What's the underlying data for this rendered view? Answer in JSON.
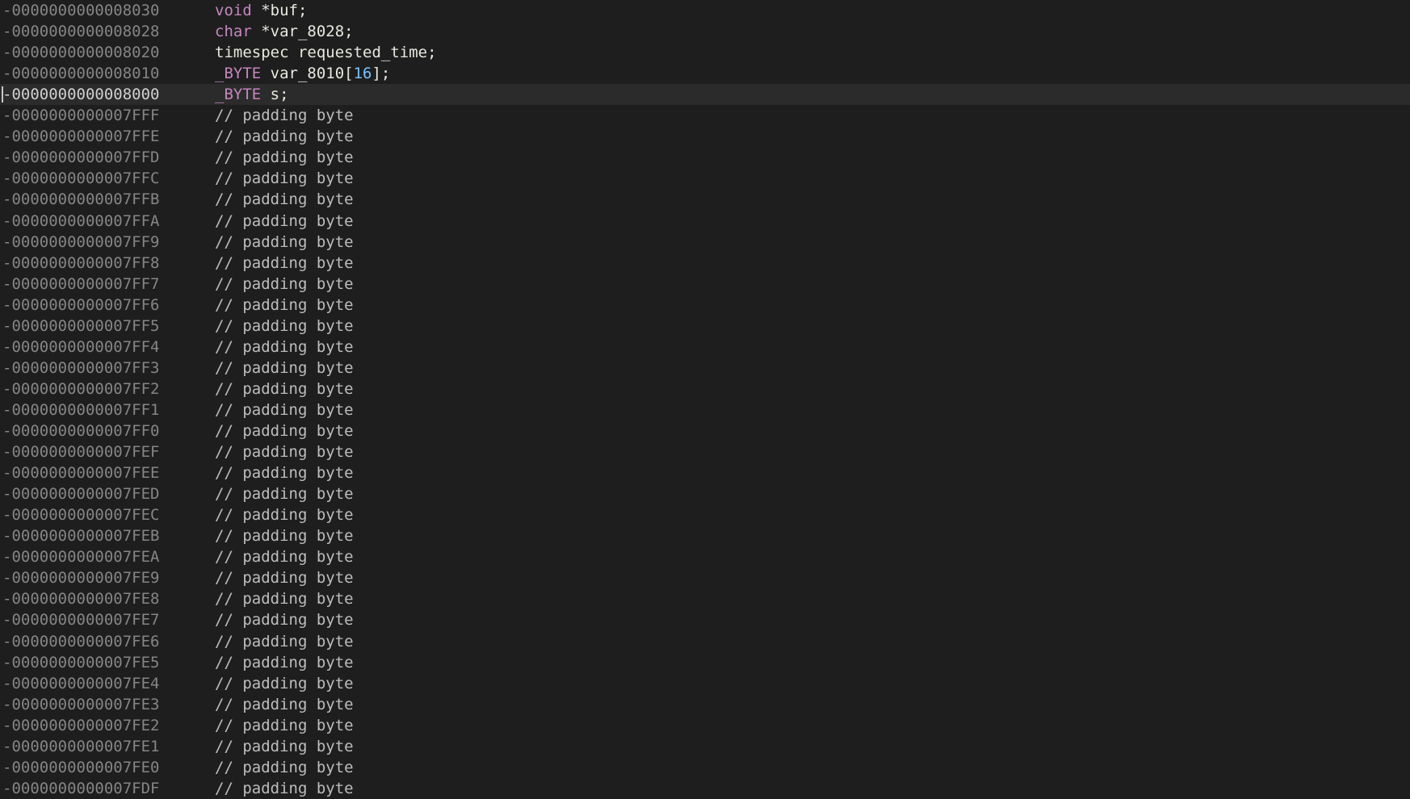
{
  "colors": {
    "background": "#1e1e1e",
    "current_line": "#2b2b2b",
    "offset": "#858585",
    "keyword": "#c586c0",
    "identifier": "#e8e8e0",
    "number": "#79c0ff",
    "comment": "#bdbdbd"
  },
  "rows": [
    {
      "offset": "-0000000000008030",
      "type": "void",
      "decl": " *buf;"
    },
    {
      "offset": "-0000000000008028",
      "type": "char",
      "decl": " *var_8028;"
    },
    {
      "offset": "-0000000000008020",
      "type": "timespec",
      "decl": " requested_time;"
    },
    {
      "offset": "-0000000000008010",
      "type": "_BYTE",
      "decl": " var_8010[",
      "num": "16",
      "tail": "];"
    },
    {
      "offset": "-0000000000008000",
      "type": "_BYTE",
      "decl": " s;",
      "current": true
    },
    {
      "offset": "-0000000000007FFF",
      "comment": "// padding byte"
    },
    {
      "offset": "-0000000000007FFE",
      "comment": "// padding byte"
    },
    {
      "offset": "-0000000000007FFD",
      "comment": "// padding byte"
    },
    {
      "offset": "-0000000000007FFC",
      "comment": "// padding byte"
    },
    {
      "offset": "-0000000000007FFB",
      "comment": "// padding byte"
    },
    {
      "offset": "-0000000000007FFA",
      "comment": "// padding byte"
    },
    {
      "offset": "-0000000000007FF9",
      "comment": "// padding byte"
    },
    {
      "offset": "-0000000000007FF8",
      "comment": "// padding byte"
    },
    {
      "offset": "-0000000000007FF7",
      "comment": "// padding byte"
    },
    {
      "offset": "-0000000000007FF6",
      "comment": "// padding byte"
    },
    {
      "offset": "-0000000000007FF5",
      "comment": "// padding byte"
    },
    {
      "offset": "-0000000000007FF4",
      "comment": "// padding byte"
    },
    {
      "offset": "-0000000000007FF3",
      "comment": "// padding byte"
    },
    {
      "offset": "-0000000000007FF2",
      "comment": "// padding byte"
    },
    {
      "offset": "-0000000000007FF1",
      "comment": "// padding byte"
    },
    {
      "offset": "-0000000000007FF0",
      "comment": "// padding byte"
    },
    {
      "offset": "-0000000000007FEF",
      "comment": "// padding byte"
    },
    {
      "offset": "-0000000000007FEE",
      "comment": "// padding byte"
    },
    {
      "offset": "-0000000000007FED",
      "comment": "// padding byte"
    },
    {
      "offset": "-0000000000007FEC",
      "comment": "// padding byte"
    },
    {
      "offset": "-0000000000007FEB",
      "comment": "// padding byte"
    },
    {
      "offset": "-0000000000007FEA",
      "comment": "// padding byte"
    },
    {
      "offset": "-0000000000007FE9",
      "comment": "// padding byte"
    },
    {
      "offset": "-0000000000007FE8",
      "comment": "// padding byte"
    },
    {
      "offset": "-0000000000007FE7",
      "comment": "// padding byte"
    },
    {
      "offset": "-0000000000007FE6",
      "comment": "// padding byte"
    },
    {
      "offset": "-0000000000007FE5",
      "comment": "// padding byte"
    },
    {
      "offset": "-0000000000007FE4",
      "comment": "// padding byte"
    },
    {
      "offset": "-0000000000007FE3",
      "comment": "// padding byte"
    },
    {
      "offset": "-0000000000007FE2",
      "comment": "// padding byte"
    },
    {
      "offset": "-0000000000007FE1",
      "comment": "// padding byte"
    },
    {
      "offset": "-0000000000007FE0",
      "comment": "// padding byte"
    },
    {
      "offset": "-0000000000007FDF",
      "comment": "// padding byte"
    }
  ]
}
